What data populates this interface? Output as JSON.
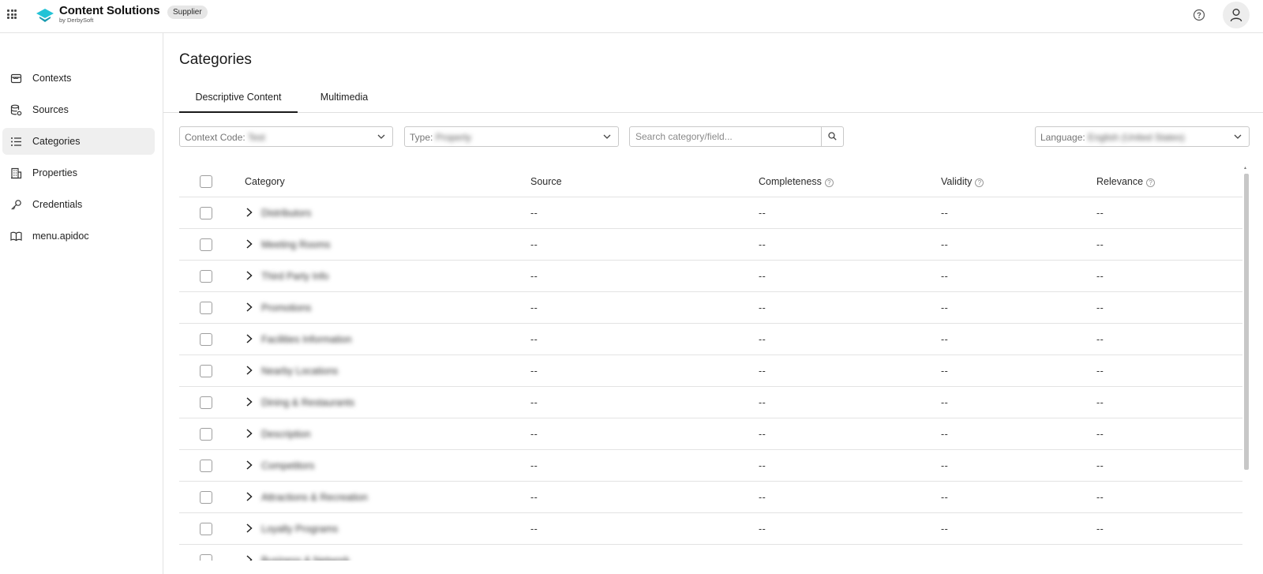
{
  "app": {
    "title": "Content Solutions",
    "subtitle": "by DerbySoft",
    "badge": "Supplier",
    "brand_color": "#22c3d6"
  },
  "sidebar": {
    "items": [
      {
        "label": "Contexts",
        "icon": "store-icon",
        "active": false
      },
      {
        "label": "Sources",
        "icon": "database-gear-icon",
        "active": false
      },
      {
        "label": "Categories",
        "icon": "list-icon",
        "active": true
      },
      {
        "label": "Properties",
        "icon": "building-icon",
        "active": false
      },
      {
        "label": "Credentials",
        "icon": "key-icon",
        "active": false
      },
      {
        "label": "menu.apidoc",
        "icon": "book-icon",
        "active": false
      }
    ]
  },
  "main": {
    "title": "Categories",
    "tabs": [
      {
        "label": "Descriptive Content",
        "active": true
      },
      {
        "label": "Multimedia",
        "active": false
      }
    ],
    "filters": {
      "context_label": "Context Code:",
      "context_value": "Test",
      "type_label": "Type:",
      "type_value": "Property",
      "search_placeholder": "Search category/field...",
      "language_label": "Language:",
      "language_value": "English (United States)"
    },
    "table": {
      "headers": {
        "category": "Category",
        "source": "Source",
        "completeness": "Completeness",
        "validity": "Validity",
        "relevance": "Relevance",
        "info_glyph": "?"
      },
      "rows": [
        {
          "category": "Distributors",
          "source": "--",
          "completeness": "--",
          "validity": "--",
          "relevance": "--"
        },
        {
          "category": "Meeting Rooms",
          "source": "--",
          "completeness": "--",
          "validity": "--",
          "relevance": "--"
        },
        {
          "category": "Third Party Info",
          "source": "--",
          "completeness": "--",
          "validity": "--",
          "relevance": "--"
        },
        {
          "category": "Promotions",
          "source": "--",
          "completeness": "--",
          "validity": "--",
          "relevance": "--"
        },
        {
          "category": "Facilities Information",
          "source": "--",
          "completeness": "--",
          "validity": "--",
          "relevance": "--"
        },
        {
          "category": "Nearby Locations",
          "source": "--",
          "completeness": "--",
          "validity": "--",
          "relevance": "--"
        },
        {
          "category": "Dining & Restaurants",
          "source": "--",
          "completeness": "--",
          "validity": "--",
          "relevance": "--"
        },
        {
          "category": "Description",
          "source": "--",
          "completeness": "--",
          "validity": "--",
          "relevance": "--"
        },
        {
          "category": "Competitors",
          "source": "--",
          "completeness": "--",
          "validity": "--",
          "relevance": "--"
        },
        {
          "category": "Attractions & Recreation",
          "source": "--",
          "completeness": "--",
          "validity": "--",
          "relevance": "--"
        },
        {
          "category": "Loyalty Programs",
          "source": "--",
          "completeness": "--",
          "validity": "--",
          "relevance": "--"
        },
        {
          "category": "Business & Network",
          "source": "--",
          "completeness": "--",
          "validity": "--",
          "relevance": "--"
        }
      ]
    }
  }
}
